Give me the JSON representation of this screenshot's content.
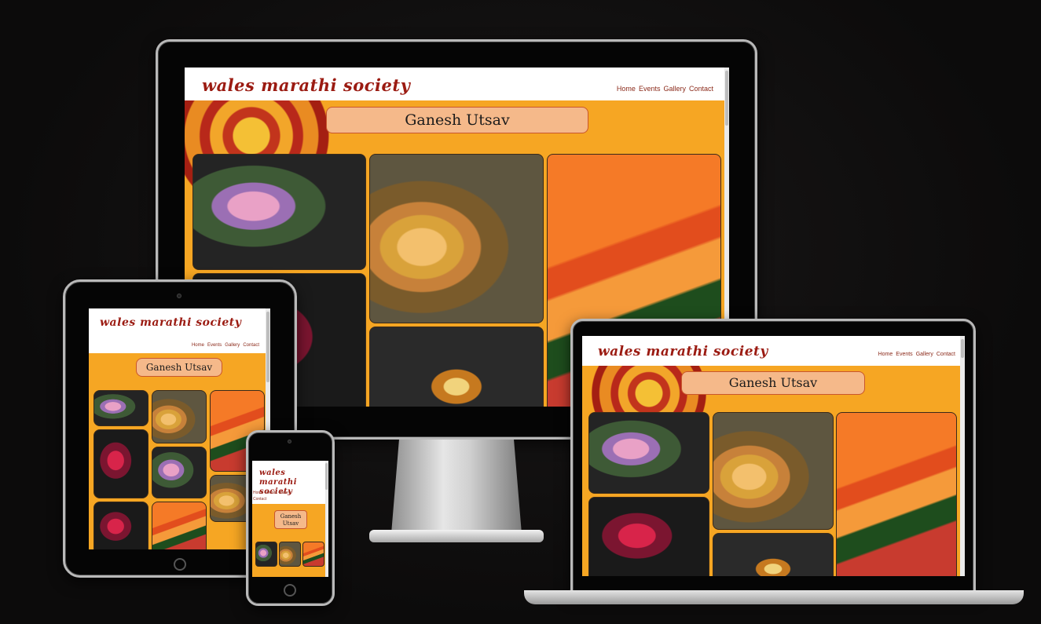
{
  "site": {
    "logo": "wales marathi society",
    "nav": [
      "Home",
      "Events",
      "Gallery",
      "Contact"
    ],
    "page_title": "Ganesh Utsav"
  },
  "colors": {
    "background": "#0e0d0d",
    "header_bg": "#ffffff",
    "logo_color": "#9b1b12",
    "nav_color": "#8b2a1a",
    "body_bg": "#f6a623",
    "title_box_bg": "#f5b98a",
    "title_box_border": "#c9562c"
  },
  "devices": [
    "desktop-monitor",
    "tablet",
    "laptop",
    "phone"
  ]
}
